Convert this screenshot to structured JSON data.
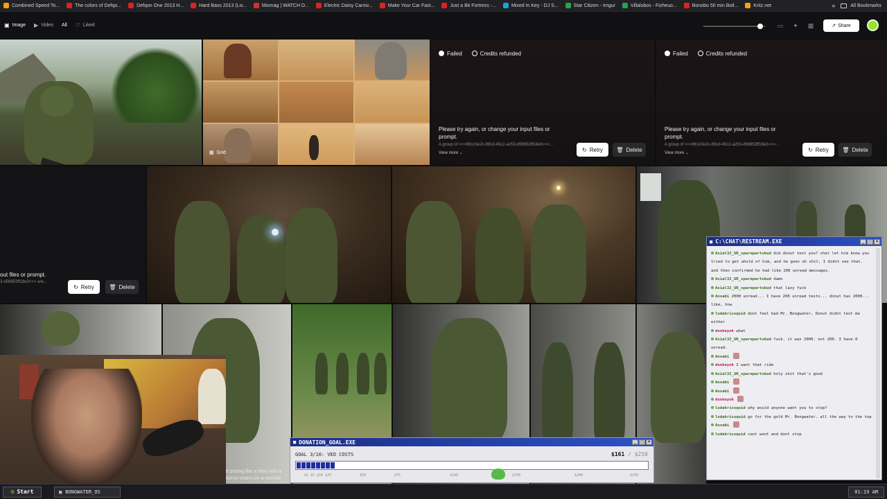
{
  "bookmarks": {
    "items": [
      {
        "label": "Combined Speed To...",
        "color": "#f2a20f"
      },
      {
        "label": "The colors of Defqo...",
        "color": "#e02020"
      },
      {
        "label": "Defqon One 2013 H...",
        "color": "#e02020"
      },
      {
        "label": "Hard Bass 2013 (Liv...",
        "color": "#e02020"
      },
      {
        "label": "Mixmag | WATCH D...",
        "color": "#d03030"
      },
      {
        "label": "Electric Daisy Carniv...",
        "color": "#e02020"
      },
      {
        "label": "Make Your Car Fast...",
        "color": "#e02020"
      },
      {
        "label": "Just a Bit Fortress -...",
        "color": "#e02020"
      },
      {
        "label": "Mixed In Key - DJ S...",
        "color": "#1aa0e0"
      },
      {
        "label": "Star Citizen - Imgur",
        "color": "#2aa34a"
      },
      {
        "label": "Villalobos - Fizheuo...",
        "color": "#2aa34a"
      },
      {
        "label": "Bonobo 50 min Boil...",
        "color": "#e02020"
      },
      {
        "label": "Kritz.net",
        "color": "#f2a20f"
      }
    ],
    "more": "»",
    "all": "All Bookmarks"
  },
  "toolbar": {
    "filters": [
      {
        "label": "Image",
        "icon": "▣"
      },
      {
        "label": "Video",
        "icon": "▶"
      },
      {
        "label": "All",
        "icon": ""
      },
      {
        "label": "Liked",
        "icon": "♡"
      }
    ],
    "share": "Share",
    "zoom_fraction": 0.9
  },
  "failed_cards": [
    {
      "status": "Failed",
      "refund": "Credits refunded",
      "message": "Please try again, or change your input files or prompt.",
      "sub": "A group of <<<661c0e2c-89cd-45c2-a253-d56653ff18e3>>>...",
      "more": "View more",
      "retry": "Retry",
      "delete": "Delete"
    },
    {
      "status": "Failed",
      "refund": "Credits refunded",
      "message": "Please try again, or change your input files or prompt.",
      "sub": "A group of <<<661c0e2c-89cd-45c2-a253-d56653ff18e3>>>...",
      "more": "View more",
      "retry": "Retry",
      "delete": "Delete"
    }
  ],
  "partial_card": {
    "message": "out files or prompt.",
    "sub": "3-d56653ff18e3>>> are...",
    "retry": "Retry",
    "delete": "Delete"
  },
  "grid_badge": "Grid",
  "caption_fragment": {
    "line1": "it posing like a hero with a",
    "line2": "donut charm on a necklac"
  },
  "donation": {
    "title": "DONATION_GOAL.EXE",
    "goal": "GOAL 3/10: VEO COSTS",
    "amount": "$161",
    "target": "/ $250",
    "progress": 0.11,
    "marks": [
      "$1 $5 $10 $25",
      "$50",
      "$75",
      "$100",
      "$150",
      "$200",
      "$250"
    ]
  },
  "chat": {
    "title": "C:\\CHAT\\RESTREAM.EXE",
    "messages": [
      {
        "user": "",
        "text": "did donut text you? chat let him know you tried to get ahold of him, and he goes oh shit, I didnt see that, and then confirmed he had like 200 unread messages.",
        "user_full": "Axial32_UR_sparepartsbud"
      },
      {
        "user_full": "Axial32_UR_sparepartsbud",
        "text": "damn"
      },
      {
        "user_full": "Axial32_UR_sparepartsbud",
        "text": "that lazy fuck"
      },
      {
        "user_full": "Aosabi",
        "text": "2000 unread... I have 200 unread texts... donut has 2000... like, how"
      },
      {
        "user_full": "ludakrissquid",
        "text": "dont feel bad Mr. Bongwater, Donut didnt text me either"
      },
      {
        "user_full": "donkeyok",
        "text": "what"
      },
      {
        "user_full": "Axial32_UR_sparepartsbud",
        "text": "fuck. it was 2000. not 200. I have 0 unread."
      },
      {
        "user_full": "Aosabi",
        "text": ""
      },
      {
        "user_full": "donkeyok",
        "text": "I want that ride"
      },
      {
        "user_full": "Axial32_UR_sparepartsbud",
        "text": "holy shit that's good"
      },
      {
        "user_full": "Aosabi",
        "text": ""
      },
      {
        "user_full": "Aosabi",
        "text": ""
      },
      {
        "user_full": "donkeyok",
        "text": ""
      },
      {
        "user_full": "ludakrissquid",
        "text": "why would anyone want you to stop?"
      },
      {
        "user_full": "ludakrissquid",
        "text": "go for the gold Mr. Bongwater. all the way to the top"
      },
      {
        "user_full": "Aosabi",
        "text": ""
      },
      {
        "user_full": "ludakrissquid",
        "text": "cant wont and dont stop"
      }
    ]
  },
  "taskbar": {
    "start": "Start",
    "task": "BONGWATER_OS",
    "clock": "01:19 AM"
  },
  "colors": {
    "accent_green": "#9be02f",
    "title_blue": "#2d52c4"
  }
}
